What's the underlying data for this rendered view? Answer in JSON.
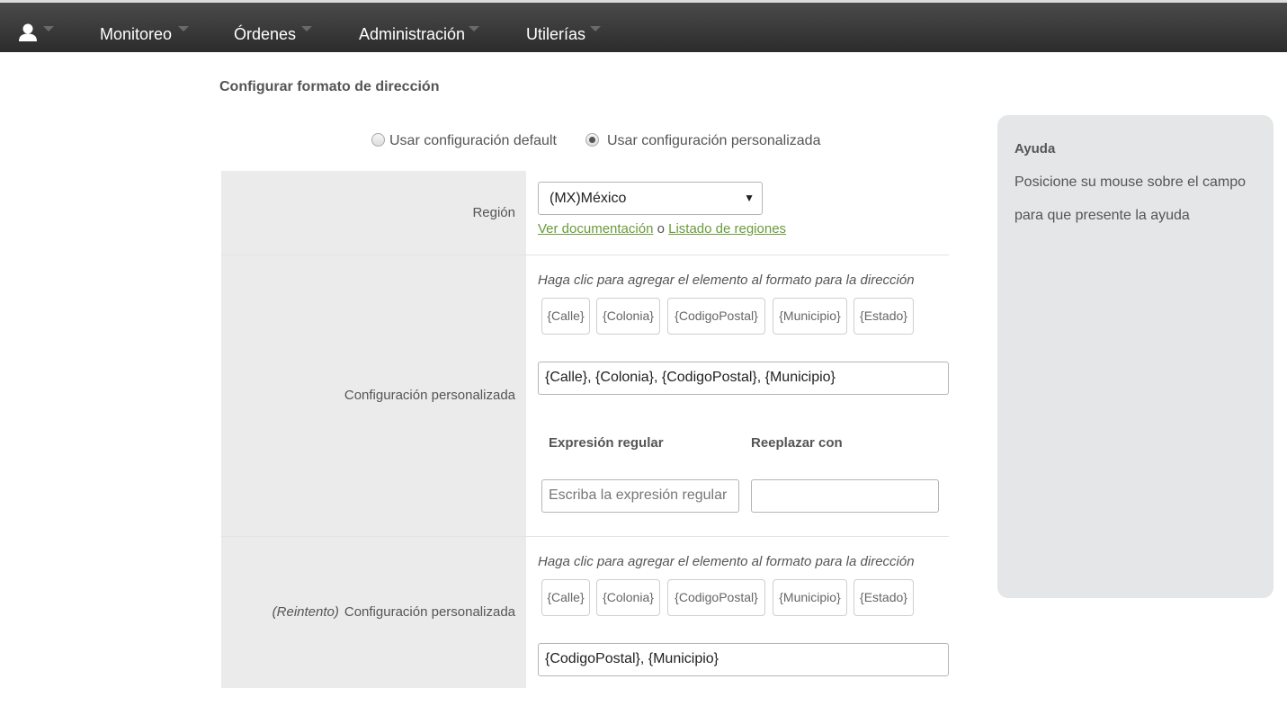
{
  "nav": {
    "items": [
      {
        "label": "Monitoreo"
      },
      {
        "label": "Órdenes"
      },
      {
        "label": "Administración"
      },
      {
        "label": "Utilerías"
      }
    ]
  },
  "page": {
    "title": "Configurar formato de dirección"
  },
  "mode": {
    "options": [
      {
        "label": "Usar configuración default",
        "checked": false
      },
      {
        "label": "Usar configuración personalizada",
        "checked": true
      }
    ]
  },
  "region": {
    "label": "Región",
    "selected": "(MX)México",
    "doc_link": "Ver documentación",
    "separator": "o",
    "regions_link": "Listado de regiones"
  },
  "custom": {
    "label": "Configuración personalizada",
    "hint": "Haga clic para agregar el elemento al formato para la dirección",
    "chips": [
      "{Calle}",
      "{Colonia}",
      "{CodigoPostal}",
      "{Municipio}",
      "{Estado}"
    ],
    "format_value": "{Calle}, {Colonia}, {CodigoPostal}, {Municipio}",
    "regex_header": "Expresión regular",
    "replace_header": "Reeplazar con",
    "regex_placeholder": "Escriba la expresión regular",
    "replace_value": ""
  },
  "retry": {
    "prefix": "(Reintento)",
    "label": "Configuración personalizada",
    "hint": "Haga clic para agregar el elemento al formato para la dirección",
    "chips": [
      "{Calle}",
      "{Colonia}",
      "{CodigoPostal}",
      "{Municipio}",
      "{Estado}"
    ],
    "format_value": "{CodigoPostal}, {Municipio}"
  },
  "help": {
    "title": "Ayuda",
    "body": "Posicione su mouse sobre el campo para que presente la ayuda"
  },
  "colors": {
    "topbar": "#333333",
    "label_bg": "#ebebeb",
    "link": "#6a9b3a",
    "help_bg": "#e5e6e8"
  }
}
